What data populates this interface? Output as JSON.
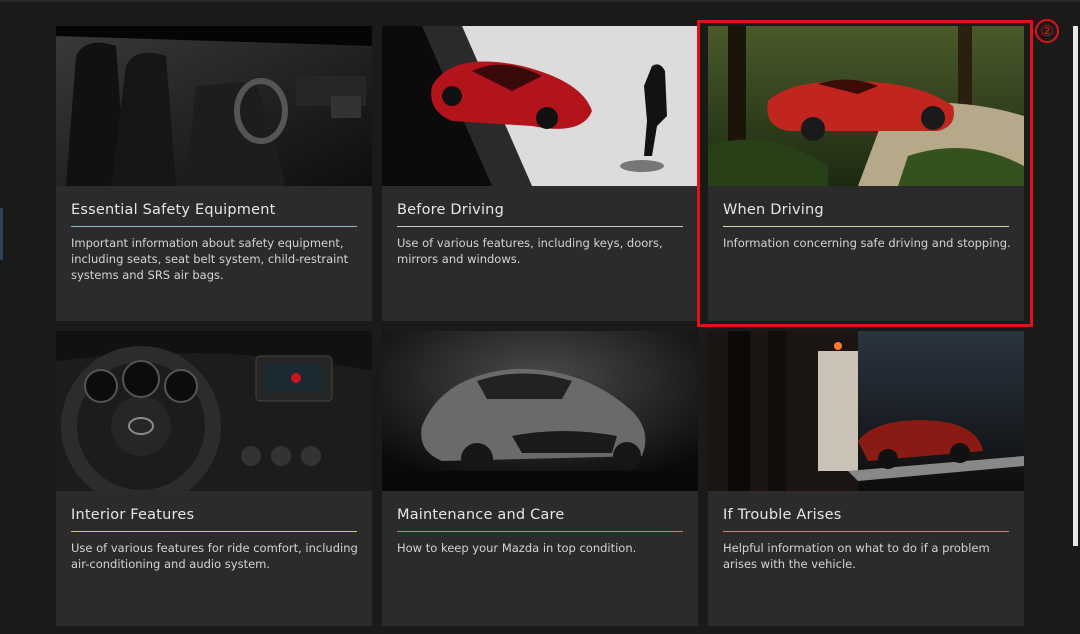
{
  "colors": {
    "background": "#1a1a1a",
    "card": "#2b2b2b",
    "highlight": "#e3111b"
  },
  "annotation": {
    "marker": "②"
  },
  "cards": [
    {
      "title": "Essential Safety Equipment",
      "description": "Important information about safety equipment, including seats, seat belt system, child-restraint systems and SRS air bags.",
      "image_subject": "car-interior-seats",
      "rule_color": "#8fb7c9"
    },
    {
      "title": "Before Driving",
      "description": "Use of various features, including keys, doors, mirrors and windows.",
      "image_subject": "red-convertible-and-man-walking",
      "rule_color": "#c9c9c9"
    },
    {
      "title": "When Driving",
      "description": "Information concerning safe driving and stopping.",
      "image_subject": "red-convertible-in-forest",
      "rule_color": "#c9d8b0"
    },
    {
      "title": "Interior Features",
      "description": "Use of various features for ride comfort, including air-conditioning and audio system.",
      "image_subject": "steering-wheel-and-dashboard",
      "rule_color": "#d9c870"
    },
    {
      "title": "Maintenance and Care",
      "description": "How to keep your Mazda in top condition.",
      "image_subject": "grey-roadster-front",
      "rule_color": "#c97e6e"
    },
    {
      "title": "If Trouble Arises",
      "description": "Helpful information on what to do if a problem arises with the vehicle.",
      "image_subject": "red-car-on-tow-truck-at-night",
      "rule_color": "#c98a6e"
    }
  ]
}
